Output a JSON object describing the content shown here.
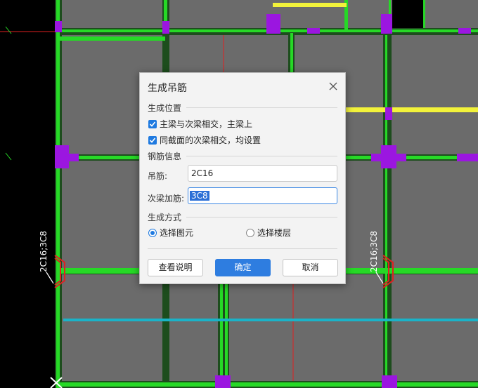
{
  "cad": {
    "label_left": "2C16;3C8",
    "label_right": "2C16;3C8",
    "colors": {
      "background": "#6b6b6b",
      "beam": "#26d926",
      "column": "#9b16e0",
      "axis": "#e02020",
      "highlight": "#f2f23a",
      "cyan": "#1ab3c8"
    }
  },
  "dialog": {
    "title": "生成吊筋",
    "close_icon": "close-icon",
    "section_position": "生成位置",
    "option_main_secondary": "主梁与次梁相交，主梁上",
    "option_same_section": "同截面的次梁相交，均设置",
    "section_rebar": "钢筋信息",
    "hanger_label": "吊筋:",
    "hanger_value": "2C16",
    "extra_label": "次梁加筋:",
    "extra_value": "3C8",
    "section_mode": "生成方式",
    "radio_select_element": "选择图元",
    "radio_select_floor": "选择楼层",
    "btn_help": "查看说明",
    "btn_ok": "确定",
    "btn_cancel": "取消",
    "accent_color": "#2e7de0"
  }
}
